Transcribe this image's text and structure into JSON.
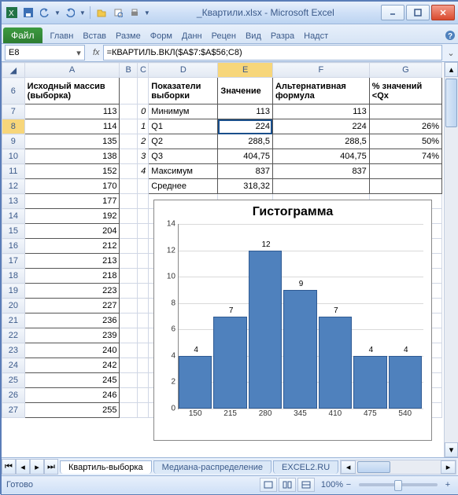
{
  "window": {
    "title": "_Квартили.xlsx - Microsoft Excel"
  },
  "ribbon": {
    "file": "Файл",
    "tabs": [
      "Главн",
      "Встав",
      "Разме",
      "Форм",
      "Данн",
      "Рецен",
      "Вид",
      "Разра",
      "Надст"
    ],
    "help": "?"
  },
  "name_box": "E8",
  "fx_label": "fx",
  "formula": "=КВАРТИЛЬ.ВКЛ($A$7:$A$56;C8)",
  "columns": [
    "A",
    "B",
    "C",
    "D",
    "E",
    "F",
    "G"
  ],
  "header_row_num": "6",
  "headers": {
    "A": "Исходный массив (выборка)",
    "D": "Показатели выборки",
    "E": "Значение",
    "F": "Альтернативная формула",
    "G": "% значений <Qx"
  },
  "rows": [
    {
      "n": "7",
      "A": "113",
      "C": "0",
      "D": "Минимум",
      "E": "113",
      "F": "113",
      "G": ""
    },
    {
      "n": "8",
      "A": "114",
      "C": "1",
      "D": "Q1",
      "E": "224",
      "F": "224",
      "G": "26%",
      "sel": true
    },
    {
      "n": "9",
      "A": "135",
      "C": "2",
      "D": "Q2",
      "E": "288,5",
      "F": "288,5",
      "G": "50%"
    },
    {
      "n": "10",
      "A": "138",
      "C": "3",
      "D": "Q3",
      "E": "404,75",
      "F": "404,75",
      "G": "74%"
    },
    {
      "n": "11",
      "A": "152",
      "C": "4",
      "D": "Максимум",
      "E": "837",
      "F": "837",
      "G": ""
    },
    {
      "n": "12",
      "A": "170",
      "C": "",
      "D": "Среднее",
      "E": "318,32",
      "F": "",
      "G": ""
    },
    {
      "n": "13",
      "A": "177"
    },
    {
      "n": "14",
      "A": "192"
    },
    {
      "n": "15",
      "A": "204"
    },
    {
      "n": "16",
      "A": "212"
    },
    {
      "n": "17",
      "A": "213"
    },
    {
      "n": "18",
      "A": "218"
    },
    {
      "n": "19",
      "A": "223"
    },
    {
      "n": "20",
      "A": "227"
    },
    {
      "n": "21",
      "A": "236"
    },
    {
      "n": "22",
      "A": "239"
    },
    {
      "n": "23",
      "A": "240"
    },
    {
      "n": "24",
      "A": "242"
    },
    {
      "n": "25",
      "A": "245"
    },
    {
      "n": "26",
      "A": "246"
    },
    {
      "n": "27",
      "A": "255"
    }
  ],
  "sheet_tabs": {
    "active": "Квартиль-выборка",
    "others": [
      "Медиана-распределение",
      "EXCEL2.RU"
    ]
  },
  "status": {
    "ready": "Готово",
    "zoom": "100%"
  },
  "chart_data": {
    "type": "bar",
    "title": "Гистограмма",
    "categories": [
      "150",
      "215",
      "280",
      "345",
      "410",
      "475",
      "540"
    ],
    "values": [
      4,
      7,
      12,
      9,
      7,
      4,
      4
    ],
    "ylim": [
      0,
      14
    ],
    "yticks": [
      0,
      2,
      4,
      6,
      8,
      10,
      12,
      14
    ]
  }
}
